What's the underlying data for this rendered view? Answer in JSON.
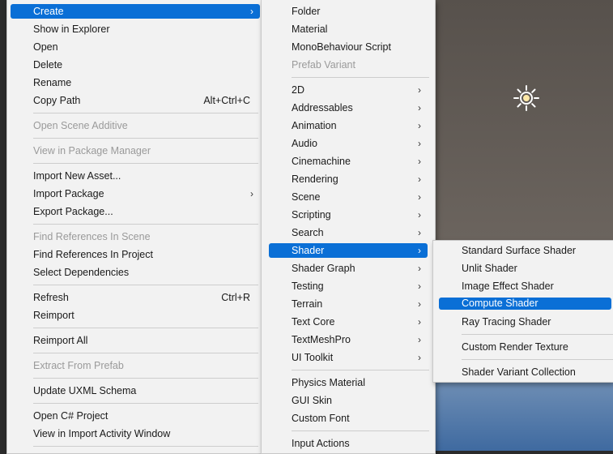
{
  "main_menu": {
    "create": "Create",
    "show_in_explorer": "Show in Explorer",
    "open": "Open",
    "delete": "Delete",
    "rename": "Rename",
    "copy_path": "Copy Path",
    "copy_path_shortcut": "Alt+Ctrl+C",
    "open_scene_additive": "Open Scene Additive",
    "view_in_package_manager": "View in Package Manager",
    "import_new_asset": "Import New Asset...",
    "import_package": "Import Package",
    "export_package": "Export Package...",
    "find_references_in_scene": "Find References In Scene",
    "find_references_in_project": "Find References In Project",
    "select_dependencies": "Select Dependencies",
    "refresh": "Refresh",
    "refresh_shortcut": "Ctrl+R",
    "reimport": "Reimport",
    "reimport_all": "Reimport All",
    "extract_from_prefab": "Extract From Prefab",
    "update_uxml_schema": "Update UXML Schema",
    "open_csharp_project": "Open C# Project",
    "view_in_import_activity_window": "View in Import Activity Window"
  },
  "create_menu": {
    "folder": "Folder",
    "material": "Material",
    "monobehaviour_script": "MonoBehaviour Script",
    "prefab_variant": "Prefab Variant",
    "2d": "2D",
    "addressables": "Addressables",
    "animation": "Animation",
    "audio": "Audio",
    "cinemachine": "Cinemachine",
    "rendering": "Rendering",
    "scene": "Scene",
    "scripting": "Scripting",
    "search": "Search",
    "shader": "Shader",
    "shader_graph": "Shader Graph",
    "testing": "Testing",
    "terrain": "Terrain",
    "text_core": "Text Core",
    "textmeshpro": "TextMeshPro",
    "ui_toolkit": "UI Toolkit",
    "physics_material": "Physics Material",
    "gui_skin": "GUI Skin",
    "custom_font": "Custom Font",
    "input_actions": "Input Actions"
  },
  "shader_menu": {
    "standard_surface_shader": "Standard Surface Shader",
    "unlit_shader": "Unlit Shader",
    "image_effect_shader": "Image Effect Shader",
    "compute_shader": "Compute Shader",
    "ray_tracing_shader": "Ray Tracing Shader",
    "custom_render_texture": "Custom Render Texture",
    "shader_variant_collection": "Shader Variant Collection"
  },
  "icons": {
    "submenu": "chevron-right-icon",
    "light": "directional-light-icon"
  },
  "colors": {
    "highlight": "#0a6fd6",
    "menu_background": "#f2f2f2",
    "disabled_text": "#9a9a9a"
  }
}
